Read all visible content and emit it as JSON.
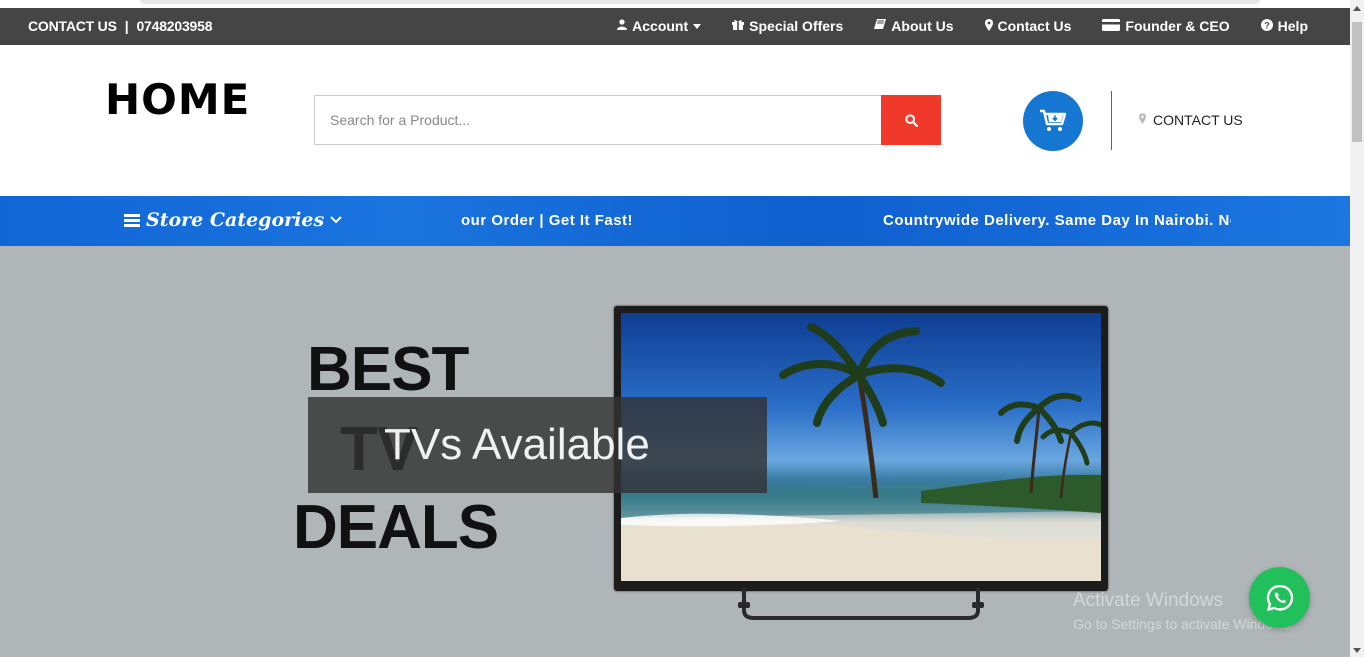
{
  "topbar": {
    "contact_label": "CONTACT US",
    "separator": "|",
    "phone": "0748203958",
    "nav": [
      {
        "label": "Account",
        "icon": "user-icon"
      },
      {
        "label": "Special Offers",
        "icon": "gift-icon"
      },
      {
        "label": "About Us",
        "icon": "book-icon"
      },
      {
        "label": "Contact Us",
        "icon": "map-marker-icon"
      },
      {
        "label": "Founder & CEO",
        "icon": "credit-card-icon"
      },
      {
        "label": "Help",
        "icon": "question-circle-icon"
      }
    ]
  },
  "header": {
    "logo": "HOME",
    "search_placeholder": "Search for a Product...",
    "contact_label": "CONTACT US"
  },
  "catbar": {
    "categories_label": "Store Categories",
    "marquee_1": "our Order | Get It Fast!",
    "marquee_2": "Countrywide Delivery. Same Day In Nairobi. Next"
  },
  "hero": {
    "line1": "BEST",
    "line2": "TV",
    "line3": "DEALS",
    "caption": "TVs Available"
  },
  "watermark": {
    "line1": "Activate Windows",
    "line2": "Go to Settings to activate Windows."
  },
  "colors": {
    "topbar_bg": "#454545",
    "accent_blue": "#1677d2",
    "search_button": "#f0392b",
    "whatsapp": "#22c05a"
  }
}
